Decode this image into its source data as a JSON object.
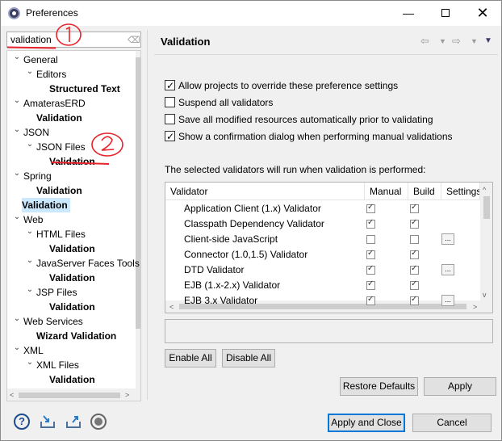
{
  "window": {
    "title": "Preferences"
  },
  "filter": {
    "value": "validation"
  },
  "tree": [
    {
      "label": "General",
      "bold": false,
      "expand": "v"
    },
    {
      "label": "Editors",
      "bold": false,
      "expand": "v"
    },
    {
      "label": "Structured Text",
      "bold": true,
      "expand": ""
    },
    {
      "label": "AmaterasERD",
      "bold": false,
      "expand": "v"
    },
    {
      "label": "Validation",
      "bold": true,
      "expand": ""
    },
    {
      "label": "JSON",
      "bold": false,
      "expand": "v"
    },
    {
      "label": "JSON Files",
      "bold": false,
      "expand": "v"
    },
    {
      "label": "Validation",
      "bold": true,
      "expand": ""
    },
    {
      "label": "Spring",
      "bold": false,
      "expand": "v"
    },
    {
      "label": "Validation",
      "bold": true,
      "expand": ""
    },
    {
      "label": "Validation",
      "bold": true,
      "expand": "",
      "selected": true
    },
    {
      "label": "Web",
      "bold": false,
      "expand": "v"
    },
    {
      "label": "HTML Files",
      "bold": false,
      "expand": "v"
    },
    {
      "label": "Validation",
      "bold": true,
      "expand": ""
    },
    {
      "label": "JavaServer Faces Tools",
      "bold": false,
      "expand": "v"
    },
    {
      "label": "Validation",
      "bold": true,
      "expand": ""
    },
    {
      "label": "JSP Files",
      "bold": false,
      "expand": "v"
    },
    {
      "label": "Validation",
      "bold": true,
      "expand": ""
    },
    {
      "label": "Web Services",
      "bold": false,
      "expand": "v"
    },
    {
      "label": "Wizard Validation",
      "bold": true,
      "expand": ""
    },
    {
      "label": "XML",
      "bold": false,
      "expand": "v"
    },
    {
      "label": "XML Files",
      "bold": false,
      "expand": "v"
    },
    {
      "label": "Validation",
      "bold": true,
      "expand": ""
    }
  ],
  "page": {
    "title": "Validation"
  },
  "options": [
    {
      "label": "Allow projects to override these preference settings",
      "checked": true
    },
    {
      "label": "Suspend all validators",
      "checked": false
    },
    {
      "label": "Save all modified resources automatically prior to validating",
      "checked": false
    },
    {
      "label": "Show a confirmation dialog when performing manual validations",
      "checked": true
    }
  ],
  "validators_label": "The selected validators will run when validation is performed:",
  "table": {
    "headers": {
      "validator": "Validator",
      "manual": "Manual",
      "build": "Build",
      "settings": "Settings"
    },
    "rows": [
      {
        "name": "Application Client (1.x) Validator",
        "manual": true,
        "build": true,
        "settings": false
      },
      {
        "name": "Classpath Dependency Validator",
        "manual": true,
        "build": true,
        "settings": false
      },
      {
        "name": "Client-side JavaScript",
        "manual": false,
        "build": false,
        "settings": true
      },
      {
        "name": "Connector (1.0,1.5) Validator",
        "manual": true,
        "build": true,
        "settings": false
      },
      {
        "name": "DTD Validator",
        "manual": true,
        "build": true,
        "settings": true
      },
      {
        "name": "EJB (1.x-2.x) Validator",
        "manual": true,
        "build": true,
        "settings": false
      },
      {
        "name": "EJB 3.x Validator",
        "manual": true,
        "build": true,
        "settings": true
      }
    ]
  },
  "buttons": {
    "enable_all": "Enable All",
    "disable_all": "Disable All",
    "restore_defaults": "Restore Defaults",
    "apply": "Apply",
    "apply_close": "Apply and Close",
    "cancel": "Cancel"
  },
  "colors": {
    "selection": "#cce8ff",
    "default_button_border": "#0078d7",
    "annotation": "#e8232b"
  }
}
